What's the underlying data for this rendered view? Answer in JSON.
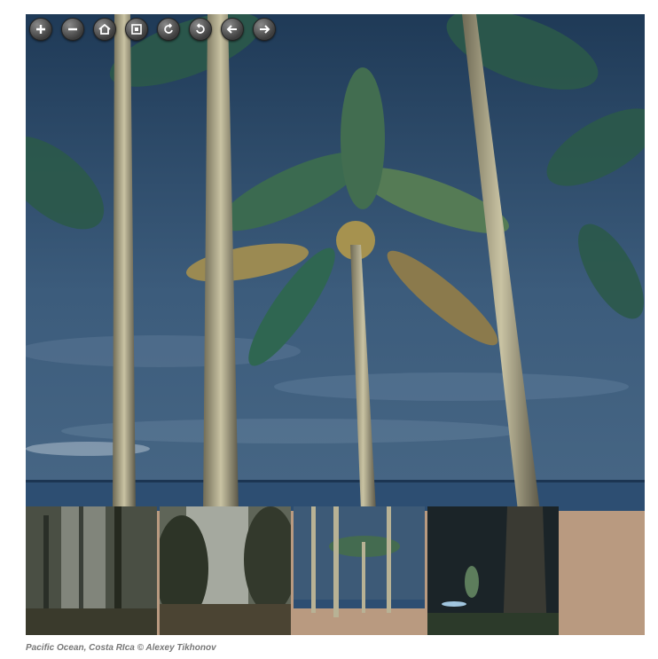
{
  "toolbar": {
    "buttons": [
      {
        "name": "zoom-in-button",
        "icon": "plus-icon"
      },
      {
        "name": "zoom-out-button",
        "icon": "minus-icon"
      },
      {
        "name": "home-button",
        "icon": "home-icon"
      },
      {
        "name": "fullpage-button",
        "icon": "fullscreen-icon"
      },
      {
        "name": "rotate-left-button",
        "icon": "rotate-left-icon"
      },
      {
        "name": "rotate-right-button",
        "icon": "rotate-right-icon"
      },
      {
        "name": "previous-button",
        "icon": "arrow-left-icon"
      },
      {
        "name": "next-button",
        "icon": "arrow-right-icon"
      }
    ]
  },
  "thumbnails": [
    {
      "name": "misty-forest-1"
    },
    {
      "name": "misty-forest-2"
    },
    {
      "name": "palm-beach",
      "active": true
    },
    {
      "name": "night-tree"
    }
  ],
  "caption": "Pacific Ocean, Costa RIca © Alexey Tikhonov",
  "colors": {
    "sky": "#2b4660",
    "sea": "#2d4e72",
    "sand": "#b99a80"
  }
}
